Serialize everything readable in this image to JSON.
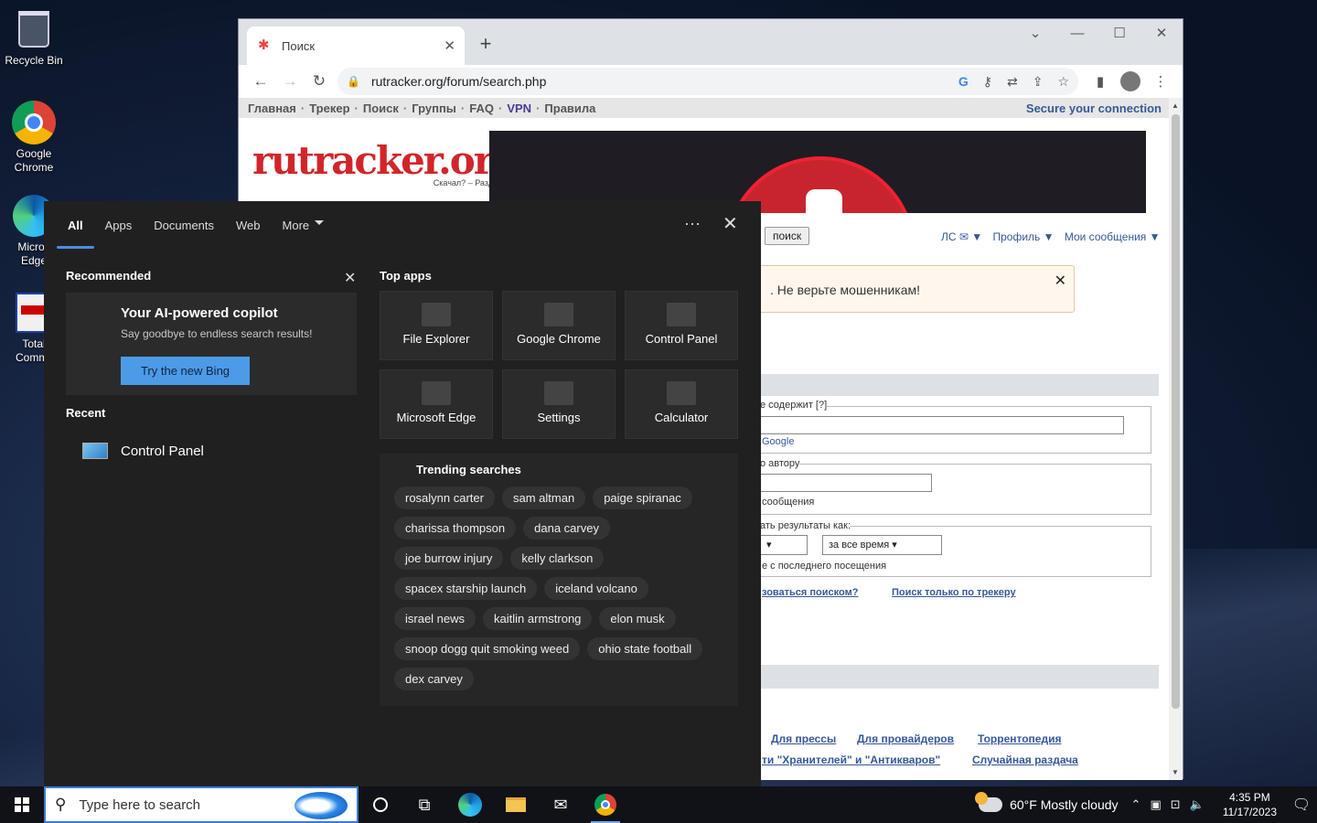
{
  "desktop": {
    "icons": [
      {
        "name": "Recycle Bin"
      },
      {
        "name": "Google Chrome"
      },
      {
        "name": "Micros Edge"
      },
      {
        "name": "Total Comma"
      }
    ]
  },
  "browser": {
    "tab_title": "Поиск",
    "url": "rutracker.org/forum/search.php",
    "page": {
      "nav": [
        "Главная",
        "Трекер",
        "Поиск",
        "Группы",
        "FAQ",
        "VPN",
        "Правила"
      ],
      "secure": "Secure your connection",
      "logo": "rutracker.org",
      "logo_tagline": "Скачал? – Раздавай!",
      "search_button": "поиск",
      "user_menu": [
        "ЛС ✉ ▼",
        "Профиль ▼",
        "Мои сообщения ▼"
      ],
      "alert": ". Не верьте мошенникам!",
      "form": {
        "contains_label": "е содержит [?]",
        "google": "Google",
        "author_label": "о автору",
        "messages": "сообщения",
        "show_as": "ать результаты как:",
        "time_select": "за все время",
        "since_last": "е с последнего посещения"
      },
      "links_mid": [
        "зоваться поиском?",
        "Поиск только по трекеру"
      ],
      "footer_links_1": [
        "Для прессы",
        "Для провайдеров",
        "Торрентопедия"
      ],
      "footer_links_2": [
        "ти \"Хранителей\" и \"Антикваров\"",
        "Случайная раздача"
      ]
    }
  },
  "search_flyout": {
    "tabs": [
      "All",
      "Apps",
      "Documents",
      "Web",
      "More"
    ],
    "recommended": "Recommended",
    "card_title": "Your AI-powered copilot",
    "card_sub": "Say goodbye to endless search results!",
    "card_button": "Try the new Bing",
    "recent_header": "Recent",
    "recent_item": "Control Panel",
    "top_apps_header": "Top apps",
    "top_apps": [
      "File Explorer",
      "Google Chrome",
      "Control Panel",
      "Microsoft Edge",
      "Settings",
      "Calculator"
    ],
    "trending_header": "Trending searches",
    "trending": [
      "rosalynn carter",
      "sam altman",
      "paige spiranac",
      "charissa thompson",
      "dana carvey",
      "joe burrow injury",
      "kelly clarkson",
      "spacex starship launch",
      "iceland volcano",
      "israel news",
      "kaitlin armstrong",
      "elon musk",
      "snoop dogg quit smoking weed",
      "ohio state football",
      "dex carvey"
    ]
  },
  "taskbar": {
    "search_placeholder": "Type here to search",
    "weather": "60°F  Mostly cloudy",
    "time": "4:35 PM",
    "date": "11/17/2023"
  }
}
